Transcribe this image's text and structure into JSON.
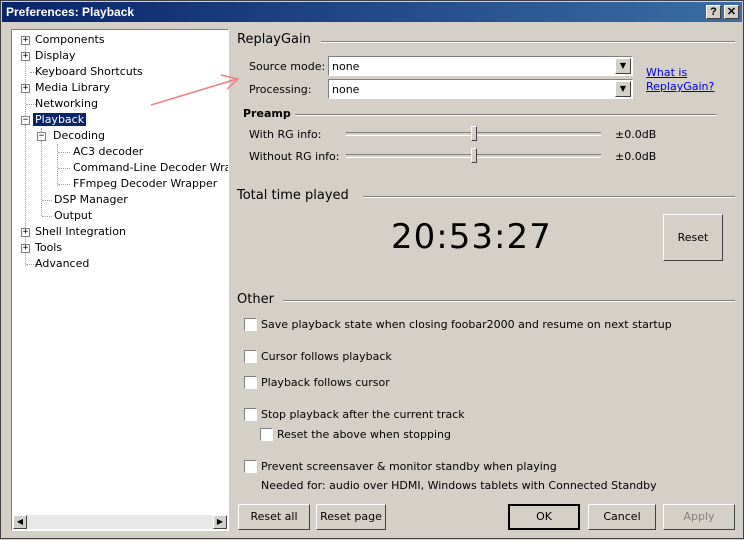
{
  "window": {
    "title": "Preferences: Playback",
    "help_btn": "?",
    "close_btn": "✕"
  },
  "tree": {
    "items": [
      {
        "label": "Components"
      },
      {
        "label": "Display"
      },
      {
        "label": "Keyboard Shortcuts"
      },
      {
        "label": "Media Library"
      },
      {
        "label": "Networking"
      },
      {
        "label": "Playback"
      },
      {
        "label": "Decoding"
      },
      {
        "label": "AC3 decoder"
      },
      {
        "label": "Command-Line Decoder Wrapper"
      },
      {
        "label": "FFmpeg Decoder Wrapper"
      },
      {
        "label": "DSP Manager"
      },
      {
        "label": "Output"
      },
      {
        "label": "Shell Integration"
      },
      {
        "label": "Tools"
      },
      {
        "label": "Advanced"
      }
    ],
    "plus": "+",
    "minus": "−",
    "scroll_left": "◀",
    "scroll_right": "▶"
  },
  "replaygain": {
    "title": "ReplayGain",
    "source_mode_label": "Source mode:",
    "source_mode_value": "none",
    "processing_label": "Processing:",
    "processing_value": "none",
    "dropdown_arrow": "▼",
    "link": "What is ReplayGain?"
  },
  "preamp": {
    "title": "Preamp",
    "with_label": "With RG info:",
    "with_value": "±0.0dB",
    "with_level": 0.5,
    "without_label": "Without RG info:",
    "without_value": "±0.0dB",
    "without_level": 0.5
  },
  "time": {
    "title": "Total time played",
    "value": "20:53:27",
    "reset": "Reset"
  },
  "other": {
    "title": "Other",
    "opt_save_state": "Save playback state when closing foobar2000 and resume on next startup",
    "opt_cursor_follows": "Cursor follows playback",
    "opt_playback_follows": "Playback follows cursor",
    "opt_stop_after": "Stop playback after the current track",
    "opt_reset_above": "Reset the above when stopping",
    "opt_prevent_screensaver": "Prevent screensaver & monitor standby when playing",
    "note": "Needed for: audio over HDMI, Windows tablets with Connected Standby"
  },
  "buttons": {
    "reset_all": "Reset all",
    "reset_page": "Reset page",
    "ok": "OK",
    "cancel": "Cancel",
    "apply": "Apply"
  },
  "colors": {
    "titlebar": "#0a246a",
    "selection": "#0a246a",
    "annotation_arrow": "#f08080"
  }
}
